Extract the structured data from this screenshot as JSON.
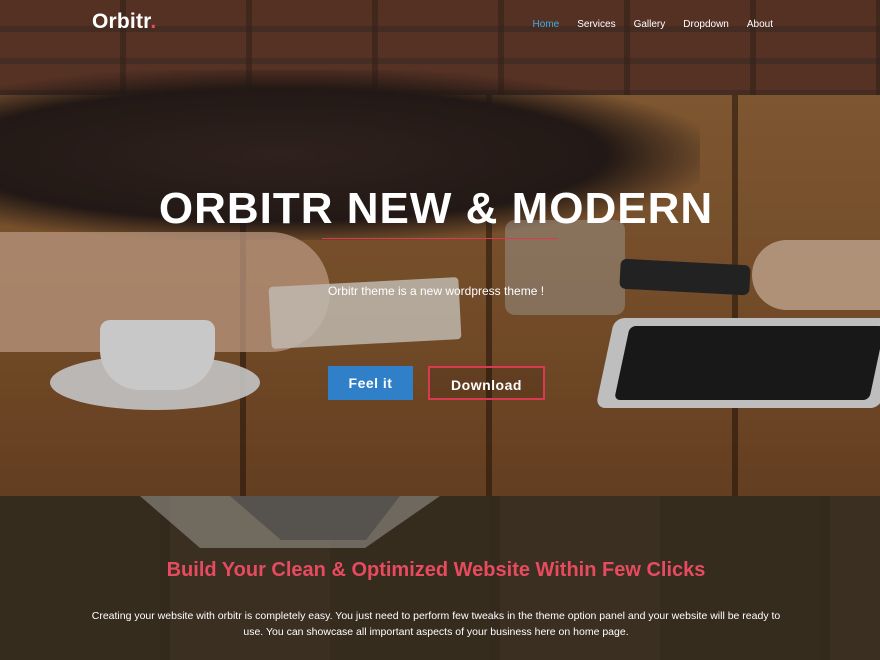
{
  "brand": {
    "name": "Orbitr",
    "dot": ".",
    "accent": "#e84a5f"
  },
  "nav": {
    "items": [
      {
        "label": "Home",
        "active": true
      },
      {
        "label": "Services",
        "active": false
      },
      {
        "label": "Gallery",
        "active": false
      },
      {
        "label": "Dropdown",
        "active": false
      },
      {
        "label": "About",
        "active": false
      }
    ],
    "active_color": "#3fa9e6"
  },
  "hero": {
    "title": "ORBITR NEW & MODERN",
    "subtitle": "Orbitr theme is a new wordpress theme !",
    "primary_button": "Feel it",
    "secondary_button": "Download",
    "primary_color": "#2f80c8",
    "secondary_border": "#d83a52"
  },
  "intro": {
    "title": "Build Your Clean & Optimized Website Within Few Clicks",
    "text": "Creating your website with orbitr is completely easy. You just need to perform few tweaks in the theme option panel and your website will be ready to use. You can showcase all important aspects of your business here on home page."
  }
}
